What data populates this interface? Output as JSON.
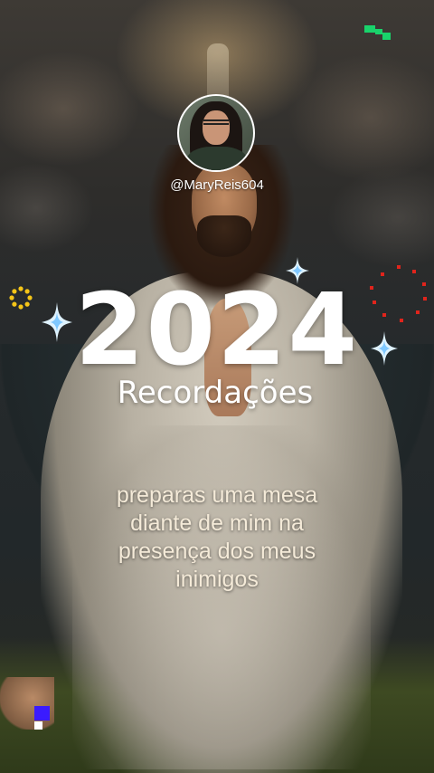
{
  "profile": {
    "username": "@MaryReis604"
  },
  "title": {
    "year": "2024",
    "subtitle": "Recordações"
  },
  "verse": {
    "lines": [
      "preparas uma mesa",
      "diante de mim na",
      "presença dos meus",
      "inimigos"
    ]
  },
  "colors": {
    "text": "#ffffff",
    "verse_text": "#f4ead8",
    "sparkle_light": "#dff3ff",
    "sparkle_blue": "#7fc8ff",
    "glitch_green": "#19d36b",
    "glitch_blue": "#3a1bff",
    "dots_red": "#e0241c",
    "ring_yellow": "#f5c518"
  },
  "icons": [
    "sparkle-icon",
    "dotted-ring-icon",
    "red-dot-circle-icon",
    "glitch-pixels-icon"
  ]
}
